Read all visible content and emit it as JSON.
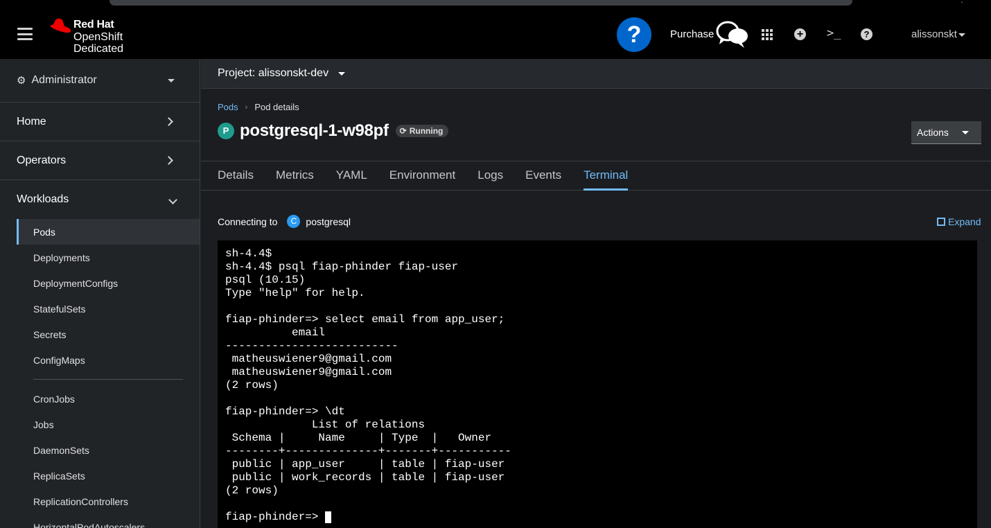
{
  "app": {
    "brand_line1": "Red Hat",
    "brand_line2": "OpenShift",
    "brand_line3": "Dedicated"
  },
  "masthead": {
    "help_glyph": "?",
    "purchase_label": "Purchase",
    "user_label": "alissonskt",
    "icons": [
      "hamburger-icon",
      "redhat-logo",
      "help-icon",
      "chat-icon",
      "app-launcher-icon",
      "add-icon",
      "terminal-icon",
      "question-icon"
    ]
  },
  "sidebar": {
    "perspective": "Administrator",
    "sections": [
      {
        "label": "Home"
      },
      {
        "label": "Operators"
      },
      {
        "label": "Workloads"
      }
    ],
    "workloads_items_group1": [
      "Pods",
      "Deployments",
      "DeploymentConfigs",
      "StatefulSets",
      "Secrets",
      "ConfigMaps"
    ],
    "workloads_items_group2": [
      "CronJobs",
      "Jobs",
      "DaemonSets",
      "ReplicaSets",
      "ReplicationControllers",
      "HorizontalPodAutoscalers"
    ],
    "active_item": "Pods"
  },
  "project": {
    "label": "Project: alissonskt-dev"
  },
  "breadcrumb": {
    "link": "Pods",
    "current": "Pod details"
  },
  "pod": {
    "badge": "P",
    "name": "postgresql-1-w98pf",
    "status": "Running",
    "actions_label": "Actions"
  },
  "tabs": [
    "Details",
    "Metrics",
    "YAML",
    "Environment",
    "Logs",
    "Events",
    "Terminal"
  ],
  "active_tab": "Terminal",
  "terminal": {
    "connecting_label": "Connecting to",
    "container_badge": "C",
    "container_name": "postgresql",
    "expand_label": "Expand",
    "lines": [
      "sh-4.4$",
      "sh-4.4$ psql fiap-phinder fiap-user",
      "psql (10.15)",
      "Type \"help\" for help.",
      "",
      "fiap-phinder=> select email from app_user;",
      "          email",
      "--------------------------",
      " matheuswiener9@gmail.com",
      " matheuswiener9@gmail.com",
      "(2 rows)",
      "",
      "fiap-phinder=> \\dt",
      "             List of relations",
      " Schema |     Name     | Type  |   Owner",
      "--------+--------------+-------+-----------",
      " public | app_user     | table | fiap-user",
      " public | work_records | table | fiap-user",
      "(2 rows)",
      ""
    ],
    "prompt": "fiap-phinder=> "
  },
  "colors": {
    "accent": "#73bcf7",
    "help_blue": "#0066cc",
    "pod_badge": "#1f9c8c",
    "container_badge": "#2b9af3",
    "redhat_red": "#ee0000"
  }
}
